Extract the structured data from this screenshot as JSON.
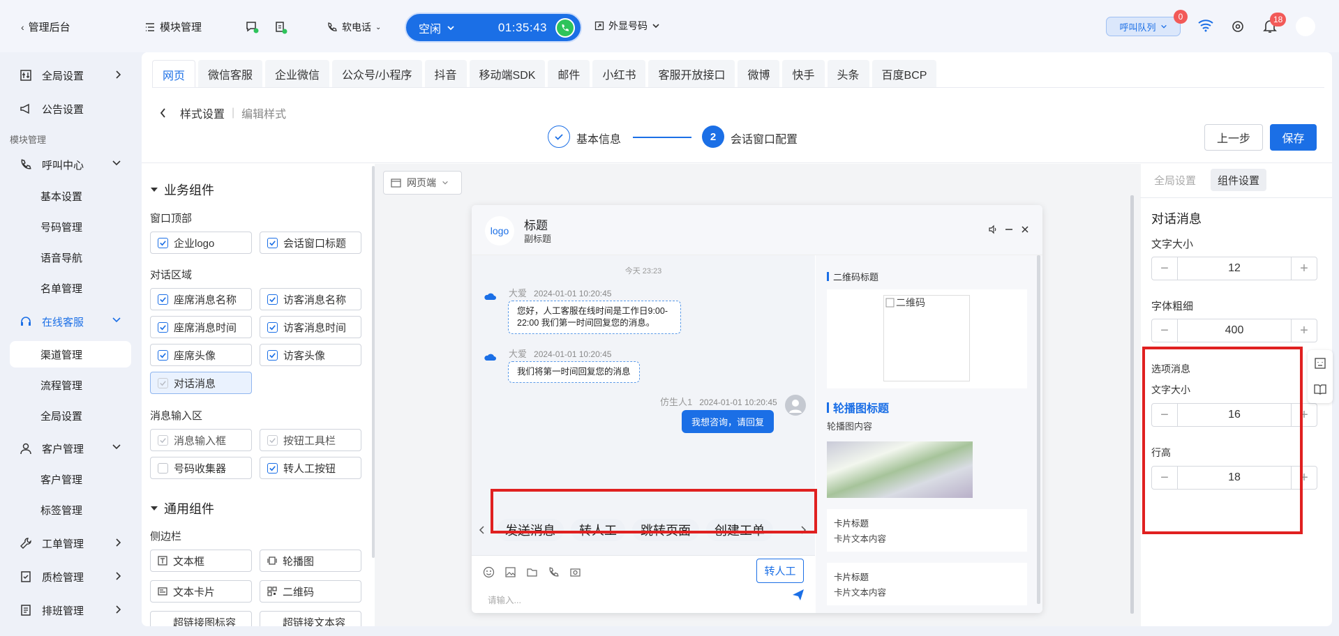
{
  "topbar": {
    "back_label": "管理后台",
    "module_label": "模块管理",
    "softphone_label": "软电话",
    "call_status": "空闲",
    "call_timer": "01:35:43",
    "outbound_label": "外显号码",
    "queue_label": "呼叫队列",
    "queue_badge": "0",
    "bell_badge": "18"
  },
  "sidebar": {
    "items": [
      {
        "label": "全局设置"
      },
      {
        "label": "公告设置"
      }
    ],
    "group_label": "模块管理",
    "call_center": {
      "label": "呼叫中心",
      "children": [
        "基本设置",
        "号码管理",
        "语音导航",
        "名单管理"
      ]
    },
    "online": {
      "label": "在线客服",
      "children": [
        "渠道管理",
        "流程管理",
        "全局设置"
      ]
    },
    "customer": {
      "label": "客户管理",
      "children": [
        "客户管理",
        "标签管理"
      ]
    },
    "ticket": {
      "label": "工单管理"
    },
    "quality": {
      "label": "质检管理"
    },
    "schedule": {
      "label": "排班管理"
    }
  },
  "tabs": [
    "网页",
    "微信客服",
    "企业微信",
    "公众号/小程序",
    "抖音",
    "移动端SDK",
    "邮件",
    "小红书",
    "客服开放接口",
    "微博",
    "快手",
    "头条",
    "百度BCP"
  ],
  "breadcrumb": {
    "parent": "样式设置",
    "current": "编辑样式"
  },
  "steps": {
    "step1": "基本信息",
    "step2_num": "2",
    "step2": "会话窗口配置"
  },
  "actions": {
    "prev": "上一步",
    "save": "保存"
  },
  "leftpanel": {
    "biz_title": "业务组件",
    "header_label": "窗口顶部",
    "header_items": [
      "企业logo",
      "会话窗口标题"
    ],
    "chat_label": "对话区域",
    "chat_items": [
      "座席消息名称",
      "访客消息名称",
      "座席消息时间",
      "访客消息时间",
      "座席头像",
      "访客头像",
      "对话消息"
    ],
    "input_label": "消息输入区",
    "input_items": [
      "消息输入框",
      "按钮工具栏",
      "号码收集器",
      "转人工按钮"
    ],
    "common_title": "通用组件",
    "sidebar_label": "侧边栏",
    "common_items": [
      "文本框",
      "轮播图",
      "文本卡片",
      "二维码",
      "超链接图标容",
      "超链接文本容"
    ]
  },
  "preview": {
    "device_label": "网页端",
    "logo": "logo",
    "title": "标题",
    "subtitle": "副标题",
    "date_divider": "今天 23:23",
    "messages": [
      {
        "name": "大爱",
        "time": "2024-01-01 10:20:45",
        "text": "您好，人工客服在线时间是工作日9:00-22:00 我们第一时间回复您的消息。"
      },
      {
        "name": "大爱",
        "time": "2024-01-01 10:20:45",
        "text": "我们将第一时间回复您的消息"
      },
      {
        "name": "仿生人1",
        "time": "2024-01-01 10:20:45",
        "text": "我想咨询，请回复"
      }
    ],
    "quick_options": [
      "发送消息",
      "转人工",
      "跳转页面",
      "创建工单"
    ],
    "transfer_button": "转人工",
    "input_placeholder": "请输入...",
    "side": {
      "qr_title": "二维码标题",
      "qr_alt": "二维码",
      "carousel_title": "轮播图标题",
      "carousel_content": "轮播图内容",
      "cards": [
        {
          "title": "卡片标题",
          "text": "卡片文本内容"
        },
        {
          "title": "卡片标题",
          "text": "卡片文本内容"
        }
      ]
    }
  },
  "rightpanel": {
    "tab_global": "全局设置",
    "tab_component": "组件设置",
    "section": "对话消息",
    "font_size_label": "文字大小",
    "font_size": "12",
    "font_weight_label": "字体粗细",
    "font_weight": "400",
    "option_label": "选项消息",
    "option_font_label": "文字大小",
    "option_font_size": "16",
    "line_height_label": "行高",
    "line_height": "18"
  },
  "colors": {
    "accent": "#1b6fe6",
    "highlight": "#e02020",
    "green": "#2ec35b"
  }
}
